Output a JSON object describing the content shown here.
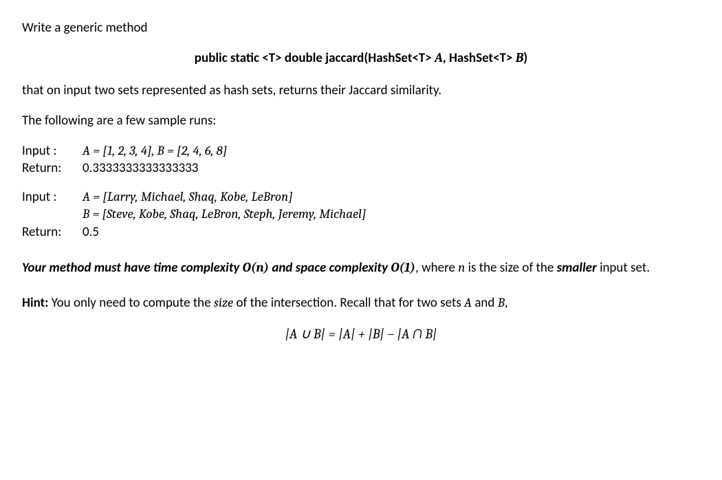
{
  "intro": "Write a generic method",
  "signature_parts": {
    "prefix": "public  static  <T>  double  jaccard(HashSet<T>  ",
    "argA": "A",
    "mid": ",  HashSet<T>  ",
    "argB": "B",
    "suffix": ")"
  },
  "desc": "that on input two sets represented as hash sets, returns their Jaccard similarity.",
  "samples_intro": "The following are a few sample runs:",
  "examples": [
    {
      "input_lines": [
        "A = [1,  2,  3,  4],   B = [2,  4,  6,  8]"
      ],
      "return": "0.3333333333333333"
    },
    {
      "input_lines": [
        "A = [Larry,  Michael,  Shaq,  Kobe,  LeBron]",
        "B = [Steve,  Kobe,  Shaq,  LeBron,  Steph,  Jeremy,  Michael]"
      ],
      "return": "0.5"
    }
  ],
  "labels": {
    "input": "Input :",
    "return": "Return:"
  },
  "constraint": {
    "lead": "Your method must have time complexity ",
    "on": "O(n)",
    "mid": " and space complexity ",
    "o1": "O(1)",
    "tail_plain": ", where ",
    "nvar": "n",
    "tail2": " is the size of the ",
    "smaller": "smaller",
    "tail3": " input set."
  },
  "hint": {
    "label": "Hint:",
    "text1": " You only need to compute the ",
    "size_word": "size",
    "text2": " of the intersection. Recall that for two sets ",
    "A": "A",
    "and": " and ",
    "B": "B",
    "comma": ","
  },
  "formula": "|A ∪ B|  =  |A|  +  |B|  −  |A ∩ B|"
}
